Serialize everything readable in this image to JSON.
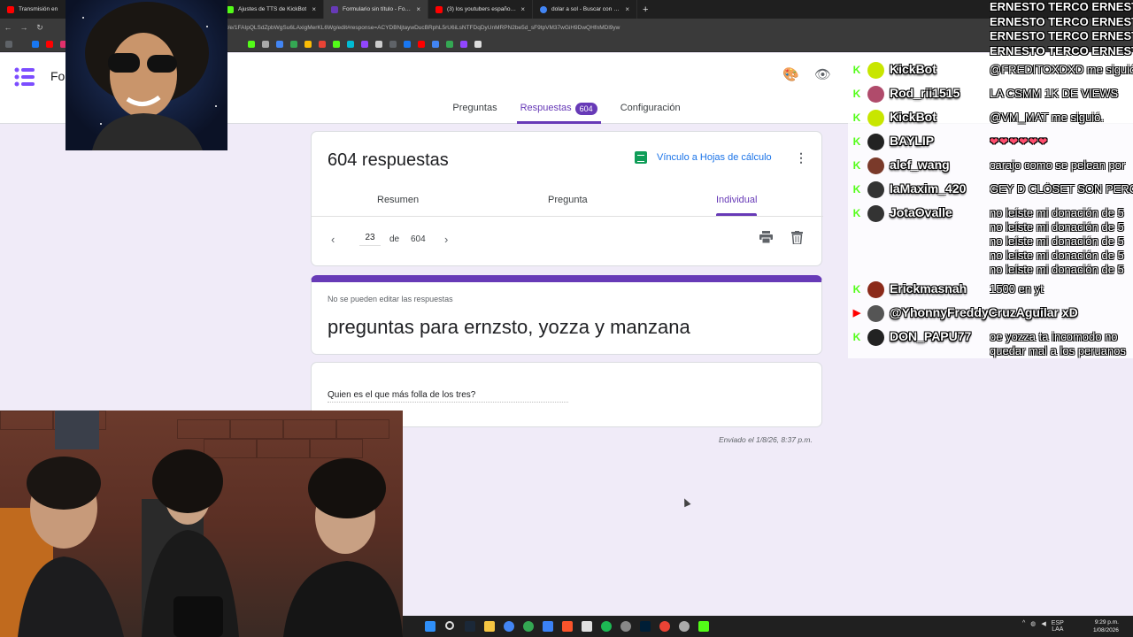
{
  "browser": {
    "tabs": [
      {
        "label": "Transmisión en",
        "color": "#ff0000"
      },
      {
        "label": "",
        "color": "#4285f4"
      },
      {
        "label": "Ajustes de TTS de KickBot",
        "color": "#53fc18"
      },
      {
        "label": "Formulario sin título - Formula",
        "color": "#673ab7"
      },
      {
        "label": "(3) los youtubers españoles má",
        "color": "#ff0000"
      },
      {
        "label": "dolar a sol - Buscar con Google",
        "color": "#4285f4"
      }
    ],
    "url": "d/e/1FAIpQLSdZpbWgSu6LAxigMerKL6Wg/edit#response=ACYDBNjtaywDucBRphL5rU6iLsNTFDqDyUnMRPN2be5d_sF9tpVM37wGiH9DwQHfnMDl9yw"
  },
  "forms": {
    "app_title": "Fo",
    "tabs": [
      {
        "label": "Preguntas"
      },
      {
        "label": "Respuestas",
        "badge": "604"
      },
      {
        "label": "Configuración"
      }
    ],
    "summary": {
      "count_text": "604 respuestas",
      "sheets_link": "Vínculo a Hojas de cálculo",
      "subtabs": [
        "Resumen",
        "Pregunta",
        "Individual"
      ],
      "pager": {
        "current": "23",
        "of": "de",
        "total": "604"
      }
    },
    "header_card": {
      "no_edit": "No se pueden editar las respuestas",
      "title": "preguntas para ernzsto, yozza y manzana"
    },
    "question": {
      "text": "Quien es el que más folla de los tres?"
    },
    "sent_at": "Enviado el 1/8/26, 8:37 p.m."
  },
  "ticker": [
    "ERNESTO TERCO ERNESTO",
    "ERNESTO TERCO ERNESTO",
    "ERNESTO TERCO ERNESTO",
    "ERNESTO TERCO ERNESTO"
  ],
  "chat": [
    {
      "user": "KickBot",
      "platform": "kick",
      "msg": "@FREDITOXDXD me siguió"
    },
    {
      "user": "Rod_rii1515",
      "platform": "kick",
      "msg": "LA CSMM 1K DE VIEWS"
    },
    {
      "user": "KickBot",
      "platform": "kick",
      "msg": "@VM_MAT me siguió."
    },
    {
      "user": "BAYLIP",
      "platform": "kick",
      "msg": "❤❤❤❤❤❤"
    },
    {
      "user": "alef_wang",
      "platform": "kick",
      "msg": "carajo como se pelean por"
    },
    {
      "user": "IaMaxim_420",
      "platform": "kick",
      "msg": "GEY D CLÓSET SON PERO"
    },
    {
      "user": "JotaOvalle",
      "platform": "kick",
      "msg": "no leíste mi donación de 5"
    },
    {
      "user": "",
      "platform": "",
      "msg": "no leíste mi donación de 5"
    },
    {
      "user": "",
      "platform": "",
      "msg": "no leíste mi donación de 5"
    },
    {
      "user": "",
      "platform": "",
      "msg": "no leíste mi donación de 5"
    },
    {
      "user": "",
      "platform": "",
      "msg": "no leíste mi donación de 5"
    },
    {
      "user": "Erickmasnah",
      "platform": "kick",
      "msg": "1500 en yt"
    },
    {
      "user": "@YhonnyFreddyCruzAguilar xD",
      "platform": "youtube",
      "msg": ""
    },
    {
      "user": "DON_PAPU77",
      "platform": "kick",
      "msg": "oe yozza ta incomodo no"
    },
    {
      "user": "",
      "platform": "",
      "msg": "quedar mal a los peruanos"
    }
  ],
  "taskbar": {
    "lang": "ESP",
    "lang2": "LAA",
    "time": "9:29 p.m.",
    "date": "1/08/2026"
  },
  "colors": {
    "accent": "#673ab7",
    "kick": "#53fc18",
    "sheets": "#0f9d58",
    "link": "#1a73e8"
  }
}
